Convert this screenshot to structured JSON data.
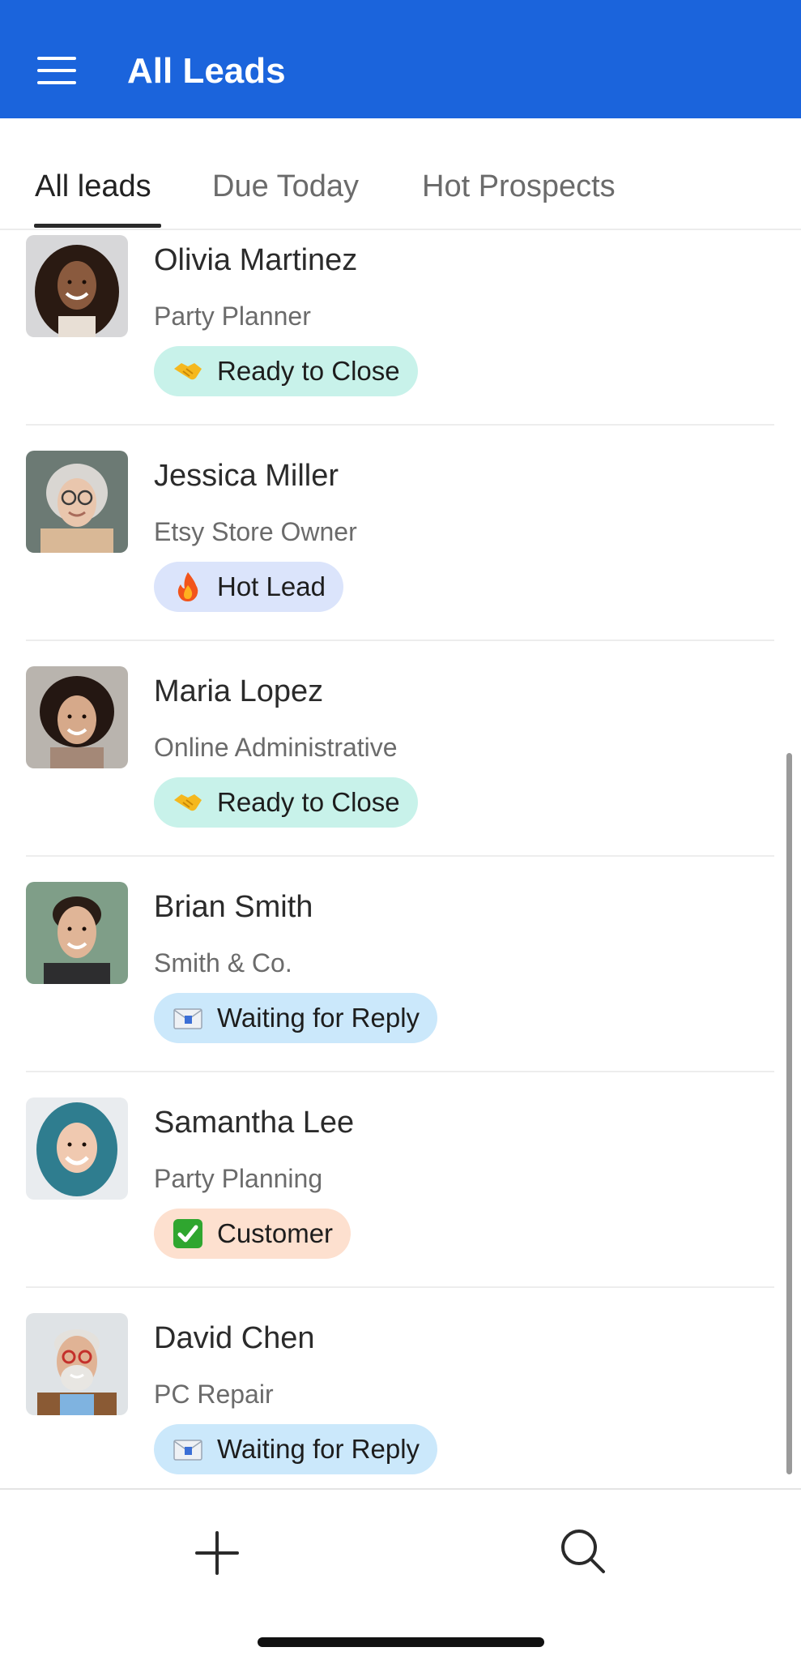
{
  "header": {
    "title": "All Leads",
    "menu_icon": "hamburger-menu-icon",
    "background": "#1b64dc"
  },
  "tabs": [
    {
      "label": "All leads",
      "active": true
    },
    {
      "label": "Due Today",
      "active": false
    },
    {
      "label": "Hot Prospects",
      "active": false
    }
  ],
  "leads": [
    {
      "name": "Olivia Martinez",
      "company": "Party Planner",
      "status": "Ready to Close",
      "status_icon": "handshake-icon"
    },
    {
      "name": "Jessica Miller",
      "company": "Etsy Store Owner",
      "status": "Hot Lead",
      "status_icon": "fire-icon"
    },
    {
      "name": "Maria Lopez",
      "company": "Online Administrative",
      "status": "Ready to Close",
      "status_icon": "handshake-icon"
    },
    {
      "name": "Brian Smith",
      "company": "Smith & Co.",
      "status": "Waiting for Reply",
      "status_icon": "envelope-icon"
    },
    {
      "name": "Samantha Lee",
      "company": "Party Planning",
      "status": "Customer",
      "status_icon": "check-mark-icon"
    },
    {
      "name": "David Chen",
      "company": "PC Repair",
      "status": "Waiting for Reply",
      "status_icon": "envelope-icon"
    }
  ],
  "bottom_bar": {
    "add_icon": "plus-icon",
    "search_icon": "search-icon"
  },
  "colors": {
    "ready_to_close": "#c8f2ea",
    "hot_lead": "#dbe4fb",
    "waiting_for_reply": "#cbe8fb",
    "customer": "#fde0cf"
  }
}
